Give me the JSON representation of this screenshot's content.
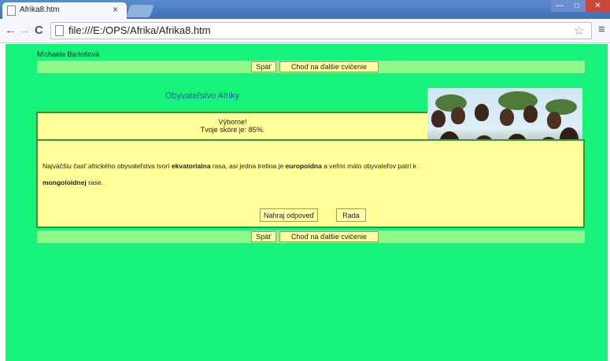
{
  "browser": {
    "tab_title": "Afrika8.htm",
    "tab_close": "×",
    "url": "file:///E:/OPS/Afrika/Afrika8.htm",
    "window_min": "—",
    "window_max": "□",
    "window_close": "✕"
  },
  "page": {
    "author": "Michaela Bartošová",
    "nav": {
      "back_label": "Späť",
      "next_label": "Choď na ďalšie cvičenie"
    },
    "title": "Obyvateľstvo Afriky",
    "result": {
      "title": "Výborne!",
      "score": "Tvoje skóre je: 85%."
    },
    "exercise": {
      "part1": "Najväčšiu časť afrického obyvateľstva tvorí ",
      "answer1": "ekvatorialna",
      "part2": " rasa, asi jedna tretina je ",
      "answer2": "europoidna",
      "part3": " a veľmi málo obyvateľov patrí k ",
      "answer3": "mongoloidnej",
      "part4": " rase.",
      "submit_label": "Nahraj odpoveď",
      "hint_label": "Rada"
    }
  },
  "icons": {
    "back": "arrow-left-icon",
    "forward": "arrow-right-icon",
    "reload": "reload-icon",
    "bookmark": "star-icon",
    "menu": "menu-icon"
  },
  "colors": {
    "page_bg": "#17f27a",
    "nav_bar": "#8ef98a",
    "panel": "#ffff99",
    "border": "#2e9a3a",
    "title": "#1a5ea8"
  }
}
